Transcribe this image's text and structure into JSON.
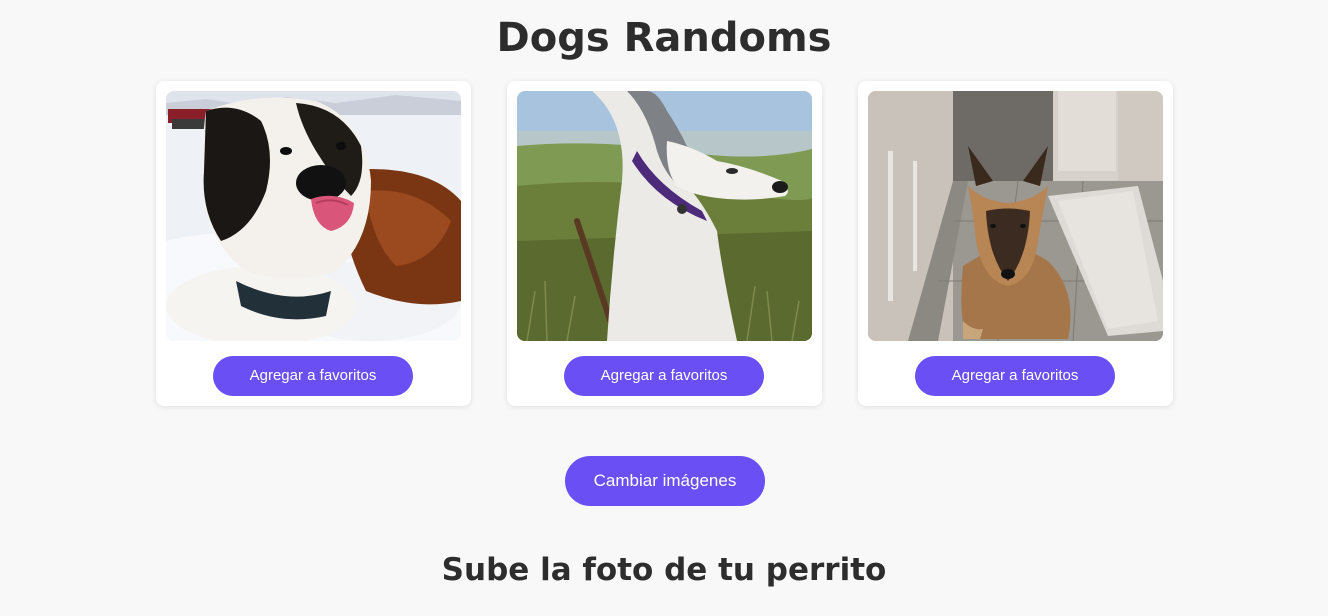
{
  "page": {
    "title": "Dogs Randoms",
    "upload_title": "Sube la foto de tu perrito"
  },
  "dogs": [
    {
      "photo_name": "saint-bernard-photo",
      "button_label": "Agregar a favoritos"
    },
    {
      "photo_name": "husky-photo",
      "button_label": "Agregar a favoritos"
    },
    {
      "photo_name": "german-shepherd-photo",
      "button_label": "Agregar a favoritos"
    }
  ],
  "actions": {
    "change_images_label": "Cambiar imágenes"
  },
  "colors": {
    "accent": "#6a4ff5",
    "background": "#f8f8f8",
    "card": "#ffffff",
    "title": "#2d2d2d"
  }
}
